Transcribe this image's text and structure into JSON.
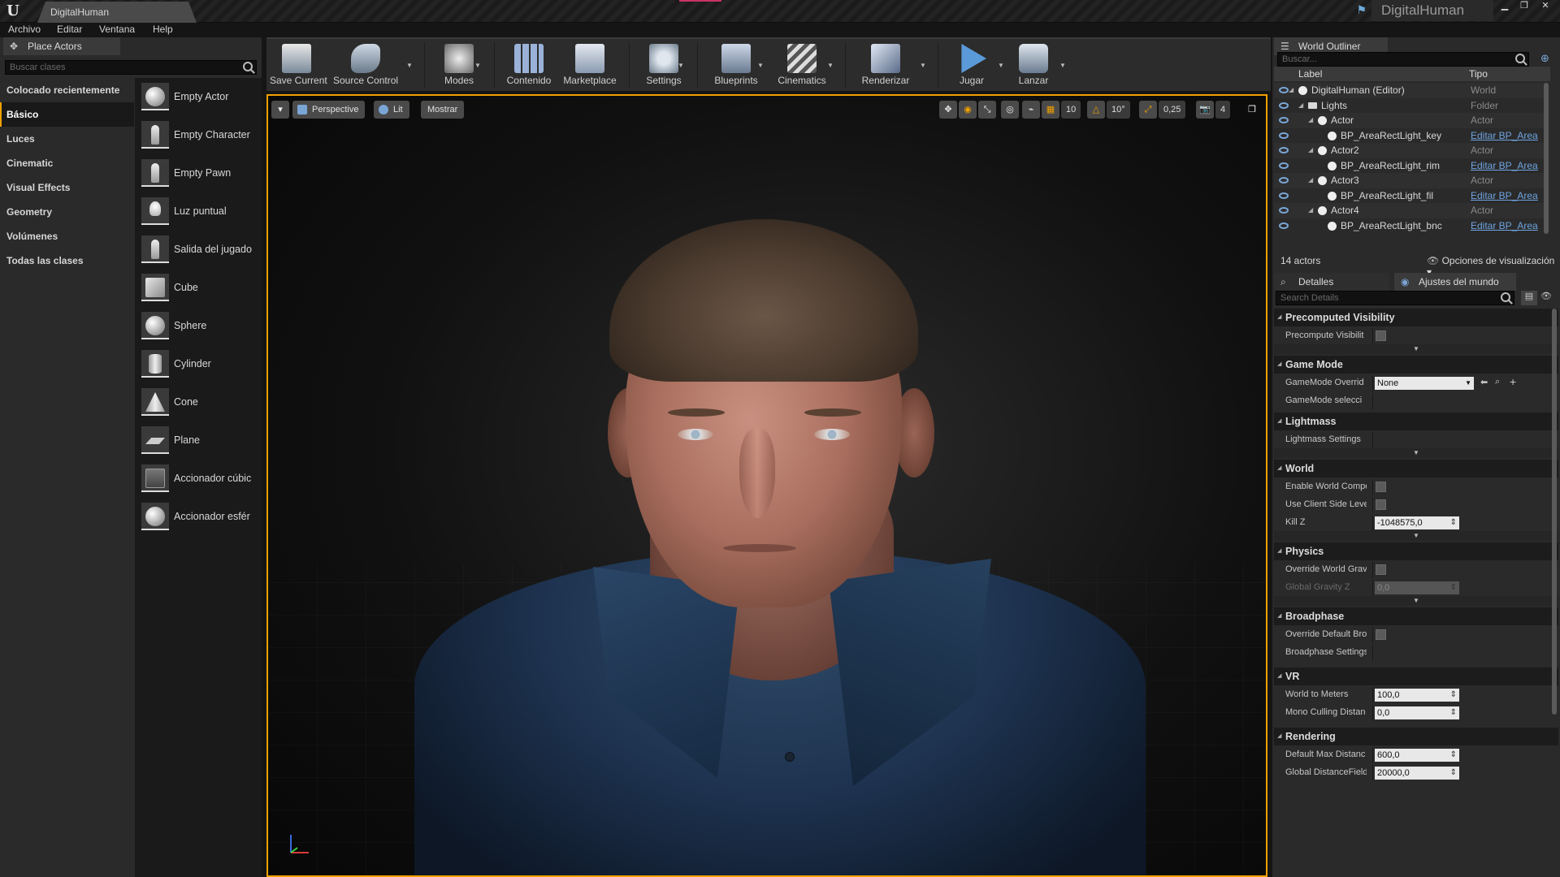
{
  "titlebar": {
    "doc_tab": "DigitalHuman",
    "project_name": "DigitalHuman"
  },
  "menu": {
    "items": [
      "Archivo",
      "Editar",
      "Ventana",
      "Help"
    ]
  },
  "place_actors": {
    "tab": "Place Actors",
    "search_placeholder": "Buscar clases",
    "categories": [
      "Colocado recientemente",
      "Básico",
      "Luces",
      "Cinematic",
      "Visual Effects",
      "Geometry",
      "Volúmenes",
      "Todas las clases"
    ],
    "active_category": "Básico",
    "actors": [
      "Empty Actor",
      "Empty Character",
      "Empty Pawn",
      "Luz puntual",
      "Salida del jugado",
      "Cube",
      "Sphere",
      "Cylinder",
      "Cone",
      "Plane",
      "Accionador cúbic",
      "Accionador esfér"
    ]
  },
  "toolbar": {
    "save": "Save Current",
    "source": "Source Control",
    "modes": "Modes",
    "content": "Contenido",
    "marketplace": "Marketplace",
    "settings": "Settings",
    "blueprints": "Blueprints",
    "cinematics": "Cinematics",
    "render": "Renderizar",
    "play": "Jugar",
    "launch": "Lanzar"
  },
  "viewport": {
    "perspective": "Perspective",
    "lit": "Lit",
    "show": "Mostrar",
    "grid_snap": "10",
    "rot_snap": "10°",
    "scale_snap": "0,25",
    "cam_speed": "4"
  },
  "outliner": {
    "tab": "World Outliner",
    "search_placeholder": "Buscar...",
    "col_label": "Label",
    "col_type": "Tipo",
    "rows": [
      {
        "label": "DigitalHuman (Editor)",
        "type": "World",
        "indent": 0,
        "link": false,
        "icon": "world"
      },
      {
        "label": "Lights",
        "type": "Folder",
        "indent": 1,
        "link": false,
        "icon": "folder"
      },
      {
        "label": "Actor",
        "type": "Actor",
        "indent": 2,
        "link": false,
        "icon": "actor"
      },
      {
        "label": "BP_AreaRectLight_key",
        "type": "Editar BP_Area",
        "indent": 3,
        "link": true,
        "icon": "actor"
      },
      {
        "label": "Actor2",
        "type": "Actor",
        "indent": 2,
        "link": false,
        "icon": "actor"
      },
      {
        "label": "BP_AreaRectLight_rim",
        "type": "Editar BP_Area",
        "indent": 3,
        "link": true,
        "icon": "actor"
      },
      {
        "label": "Actor3",
        "type": "Actor",
        "indent": 2,
        "link": false,
        "icon": "actor"
      },
      {
        "label": "BP_AreaRectLight_fil",
        "type": "Editar BP_Area",
        "indent": 3,
        "link": true,
        "icon": "actor"
      },
      {
        "label": "Actor4",
        "type": "Actor",
        "indent": 2,
        "link": false,
        "icon": "actor"
      },
      {
        "label": "BP_AreaRectLight_bnc",
        "type": "Editar BP_Area",
        "indent": 3,
        "link": true,
        "icon": "actor"
      }
    ],
    "count": "14 actors",
    "view_options": "Opciones de visualización"
  },
  "details": {
    "tab_details": "Detalles",
    "tab_world": "Ajustes del mundo",
    "search_placeholder": "Search Details",
    "sections": {
      "precomputed": "Precomputed Visibility",
      "gamemode": "Game Mode",
      "lightmass": "Lightmass",
      "world": "World",
      "physics": "Physics",
      "broadphase": "Broadphase",
      "vr": "VR",
      "rendering": "Rendering"
    },
    "props": {
      "precompute_vis": "Precompute Visibilit",
      "gamemode_override": "GameMode Overrid",
      "gamemode_value": "None",
      "gamemode_select": "GameMode selecci",
      "lightmass_settings": "Lightmass Settings",
      "enable_world_comp": "Enable World Compo",
      "use_client_side": "Use Client Side Leve",
      "kill_z": "Kill Z",
      "kill_z_value": "-1048575,0",
      "override_gravity": "Override World Grav",
      "global_gravity": "Global Gravity Z",
      "global_gravity_value": "0,0",
      "override_broadphase": "Override Default Bro",
      "broadphase_settings": "Broadphase Settings",
      "world_to_meters": "World to Meters",
      "world_to_meters_value": "100,0",
      "mono_culling": "Mono Culling Distan",
      "mono_culling_value": "0,0",
      "default_max_dist": "Default Max Distanc",
      "default_max_dist_value": "600,0",
      "global_df": "Global DistanceField",
      "global_df_value": "20000,0"
    }
  },
  "colors": {
    "accent": "#f1a000",
    "link": "#6fa4e0",
    "eye": "#7aa6d6"
  }
}
